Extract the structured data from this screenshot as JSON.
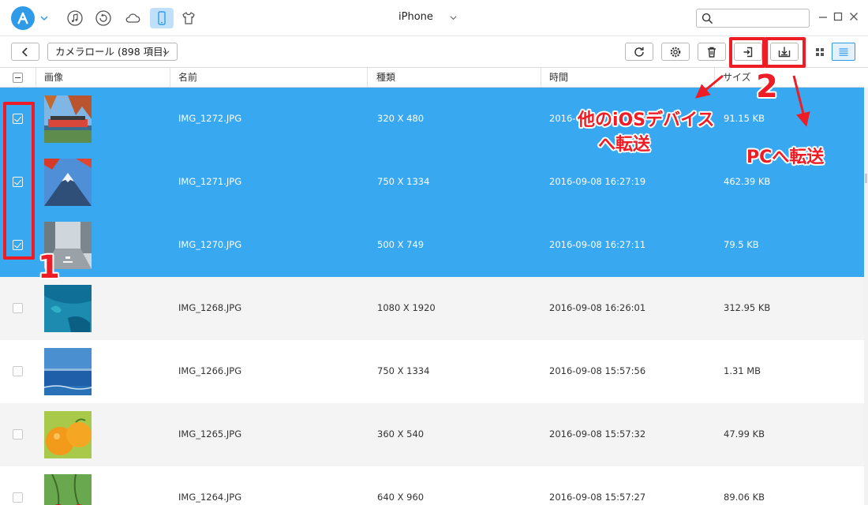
{
  "titlebar": {
    "device_name": "iPhone",
    "search_placeholder": "",
    "icons": [
      "anytrans-logo-icon",
      "music-icon",
      "restore-icon",
      "cloud-icon",
      "phone-icon",
      "shirt-icon"
    ]
  },
  "toolbar": {
    "album_label": "カメラロール (898 項目)"
  },
  "table": {
    "columns": {
      "image": "画像",
      "name": "名前",
      "type": "種類",
      "time": "時間",
      "size": "サイズ"
    },
    "rows": [
      {
        "name": "IMG_1272.JPG",
        "dims": "320 X 480",
        "time": "2016-0",
        "size": "91.15 KB",
        "selected": true
      },
      {
        "name": "IMG_1271.JPG",
        "dims": "750 X 1334",
        "time": "2016-09-08 16:27:19",
        "size": "462.39 KB",
        "selected": true
      },
      {
        "name": "IMG_1270.JPG",
        "dims": "500 X 749",
        "time": "2016-09-08 16:27:11",
        "size": "79.5 KB",
        "selected": true
      },
      {
        "name": "IMG_1268.JPG",
        "dims": "1080 X 1920",
        "time": "2016-09-08 16:26:01",
        "size": "312.95 KB",
        "selected": false
      },
      {
        "name": "IMG_1266.JPG",
        "dims": "750 X 1334",
        "time": "2016-09-08 15:57:56",
        "size": "1.31 MB",
        "selected": false
      },
      {
        "name": "IMG_1265.JPG",
        "dims": "360 X 540",
        "time": "2016-09-08 15:57:32",
        "size": "47.99 KB",
        "selected": false
      },
      {
        "name": "IMG_1264.JPG",
        "dims": "640 X 960",
        "time": "2016-09-08 15:57:27",
        "size": "89.06 KB",
        "selected": false
      }
    ]
  },
  "annotations": {
    "step1": "1",
    "step2": "2",
    "to_ios_line1": "他のiOSデバイス",
    "to_ios_line2": "へ転送",
    "to_pc": "PCへ転送",
    "color": "#ee1c24"
  },
  "colors": {
    "accent": "#2f9be8",
    "selected_row": "#38a8f0"
  }
}
